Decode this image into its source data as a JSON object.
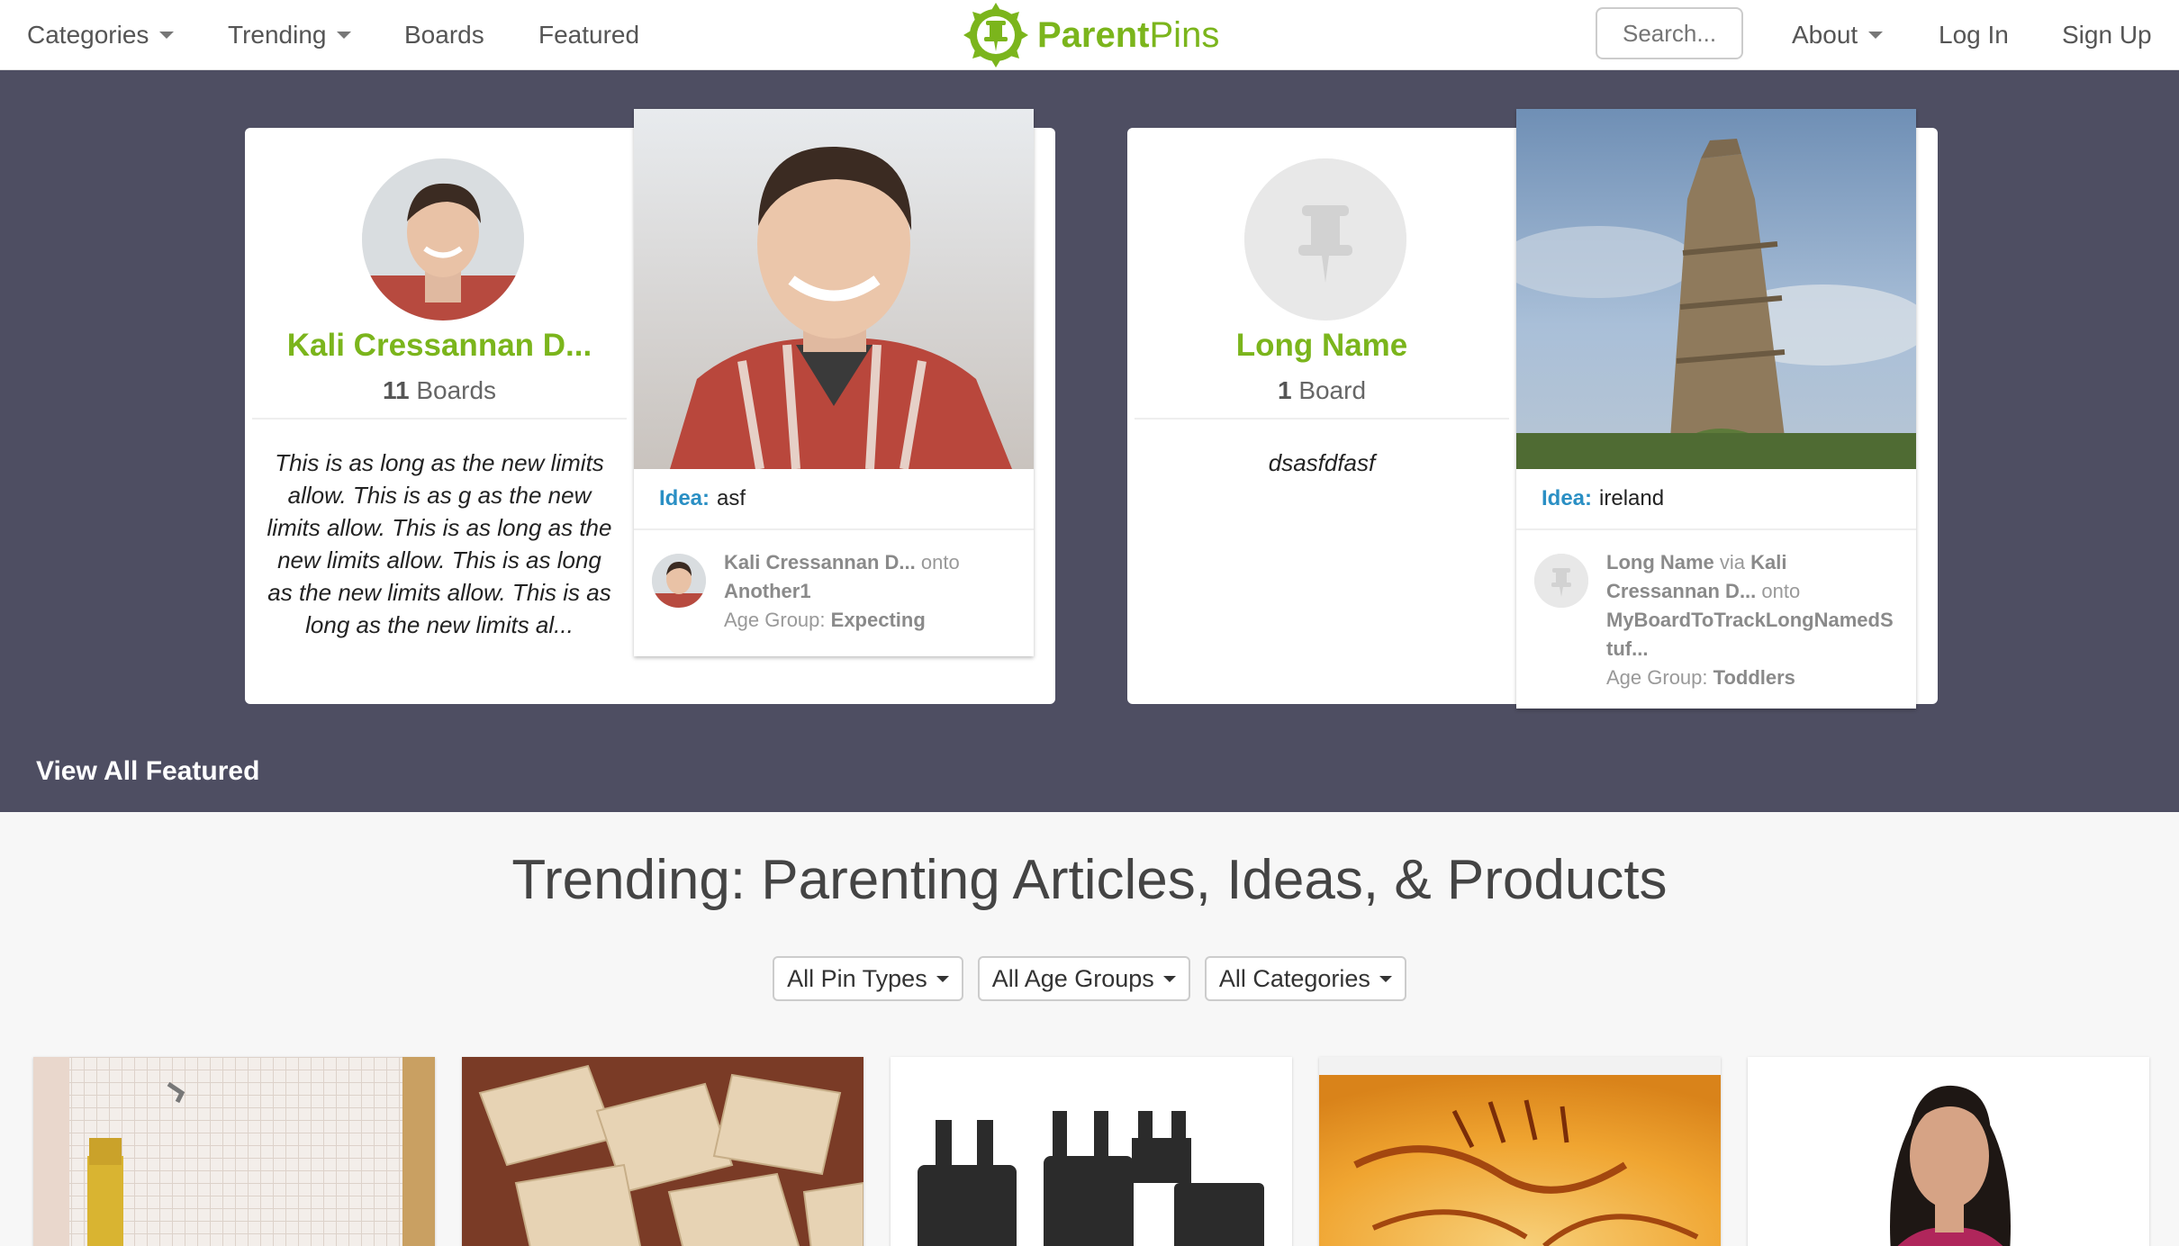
{
  "nav": {
    "categories": "Categories",
    "trending": "Trending",
    "boards": "Boards",
    "featured": "Featured",
    "about": "About",
    "login": "Log In",
    "signup": "Sign Up",
    "search_placeholder": "Search..."
  },
  "brand": {
    "name_bold": "Parent",
    "name_light": "Pins",
    "icon": "pushpin-badge-icon"
  },
  "colors": {
    "brand_green": "#7bb51c",
    "featured_bg": "#4e4e62",
    "idea_blue": "#2a8fc4"
  },
  "featured": {
    "cards": [
      {
        "profile_name": "Kali Cressannan D...",
        "board_count": "11",
        "board_word": "Boards",
        "description": "This is as long as the new limits allow. This is as g as the new limits allow. This is as long as the new limits allow. This is as long as the new limits allow. This is as long as the new limits al...",
        "pin": {
          "idea_label": "Idea:",
          "idea_text": "asf",
          "meta_lines": [
            {
              "bold": "Kali Cressannan D...",
              "plain": " onto"
            },
            {
              "bold": "Another1",
              "plain": ""
            },
            {
              "plain": "Age Group: ",
              "bold": "Expecting"
            }
          ]
        }
      },
      {
        "profile_name": "Long Name",
        "board_count": "1",
        "board_word": "Board",
        "description": "dsasfdfasf",
        "pin": {
          "idea_label": "Idea:",
          "idea_text": "ireland",
          "meta_lines": [
            {
              "bold": "Long Name",
              "plain": " via ",
              "bold2": "Kali"
            },
            {
              "bold": "Cressannan D...",
              "plain": " onto"
            },
            {
              "bold": "MyBoardToTrackLongNamedS",
              "plain": ""
            },
            {
              "bold": "tuf...",
              "plain": ""
            },
            {
              "plain": "Age Group: ",
              "bold": "Toddlers"
            }
          ]
        }
      }
    ],
    "view_all": "View All Featured"
  },
  "trending": {
    "title": "Trending: Parenting Articles, Ideas, & Products",
    "filters": [
      "All Pin Types",
      "All Age Groups",
      "All Categories"
    ]
  }
}
